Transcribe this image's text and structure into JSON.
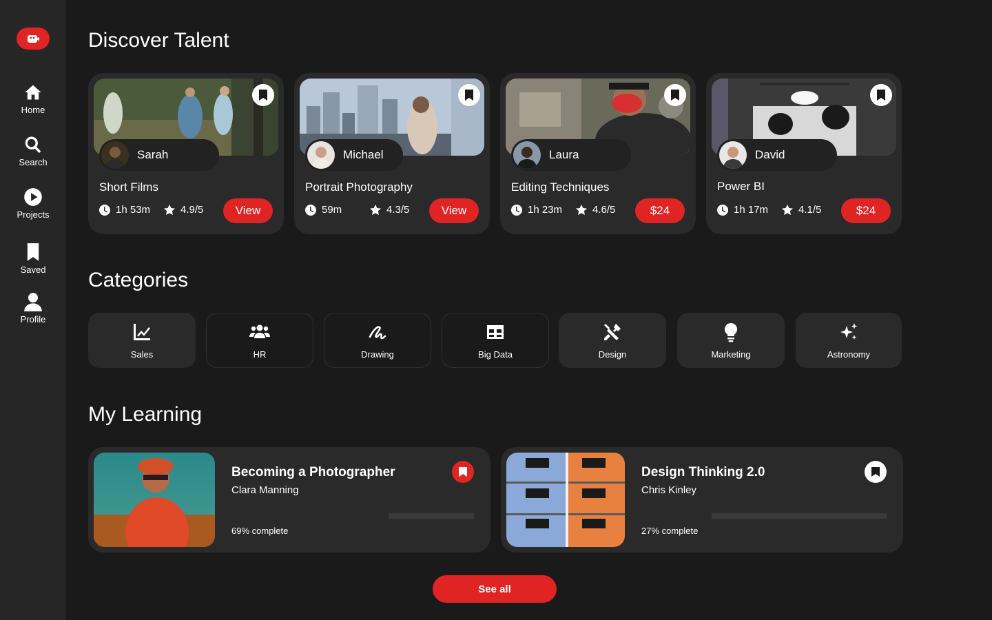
{
  "sidebar": {
    "logo_icon": "film-reel-icon",
    "items": [
      {
        "label": "Home",
        "icon": "home-icon"
      },
      {
        "label": "Search",
        "icon": "search-icon"
      },
      {
        "label": "Projects",
        "icon": "play-icon"
      },
      {
        "label": "Saved",
        "icon": "bookmark-icon"
      },
      {
        "label": "Profile",
        "icon": "user-icon"
      }
    ]
  },
  "discover": {
    "title": "Discover Talent",
    "cards": [
      {
        "author": "Sarah",
        "title": "Short Films",
        "duration": "1h 53m",
        "rating": "4.9/5",
        "button": "View"
      },
      {
        "author": "Michael",
        "title": "Portrait Photography",
        "duration": "59m",
        "rating": "4.3/5",
        "button": "View"
      },
      {
        "author": "Laura",
        "title": "Editing Techniques",
        "duration": "1h 23m",
        "rating": "4.6/5",
        "button": "$24"
      },
      {
        "author": "David",
        "title": "Power BI",
        "duration": "1h 17m",
        "rating": "4.1/5",
        "button": "$24"
      }
    ]
  },
  "categories": {
    "title": "Categories",
    "items": [
      {
        "label": "Sales",
        "icon": "chart-line-icon"
      },
      {
        "label": "HR",
        "icon": "users-icon"
      },
      {
        "label": "Drawing",
        "icon": "signature-icon"
      },
      {
        "label": "Big Data",
        "icon": "table-icon"
      },
      {
        "label": "Design",
        "icon": "tools-icon"
      },
      {
        "label": "Marketing",
        "icon": "lightbulb-icon"
      },
      {
        "label": "Astronomy",
        "icon": "sparkles-icon"
      }
    ]
  },
  "learning": {
    "title": "My Learning",
    "items": [
      {
        "title": "Becoming a Photographer",
        "author": "Clara Manning",
        "progress_text": "69% complete",
        "progress": 0.69,
        "saved": true
      },
      {
        "title": "Design Thinking 2.0",
        "author": "Chris Kinley",
        "progress_text": "27% complete",
        "progress": 0.27,
        "saved": false
      }
    ],
    "see_all": "See all"
  },
  "colors": {
    "accent": "#e02424",
    "background": "#1a1a1a",
    "sidebar": "#262626",
    "card": "#2a2a2a"
  }
}
